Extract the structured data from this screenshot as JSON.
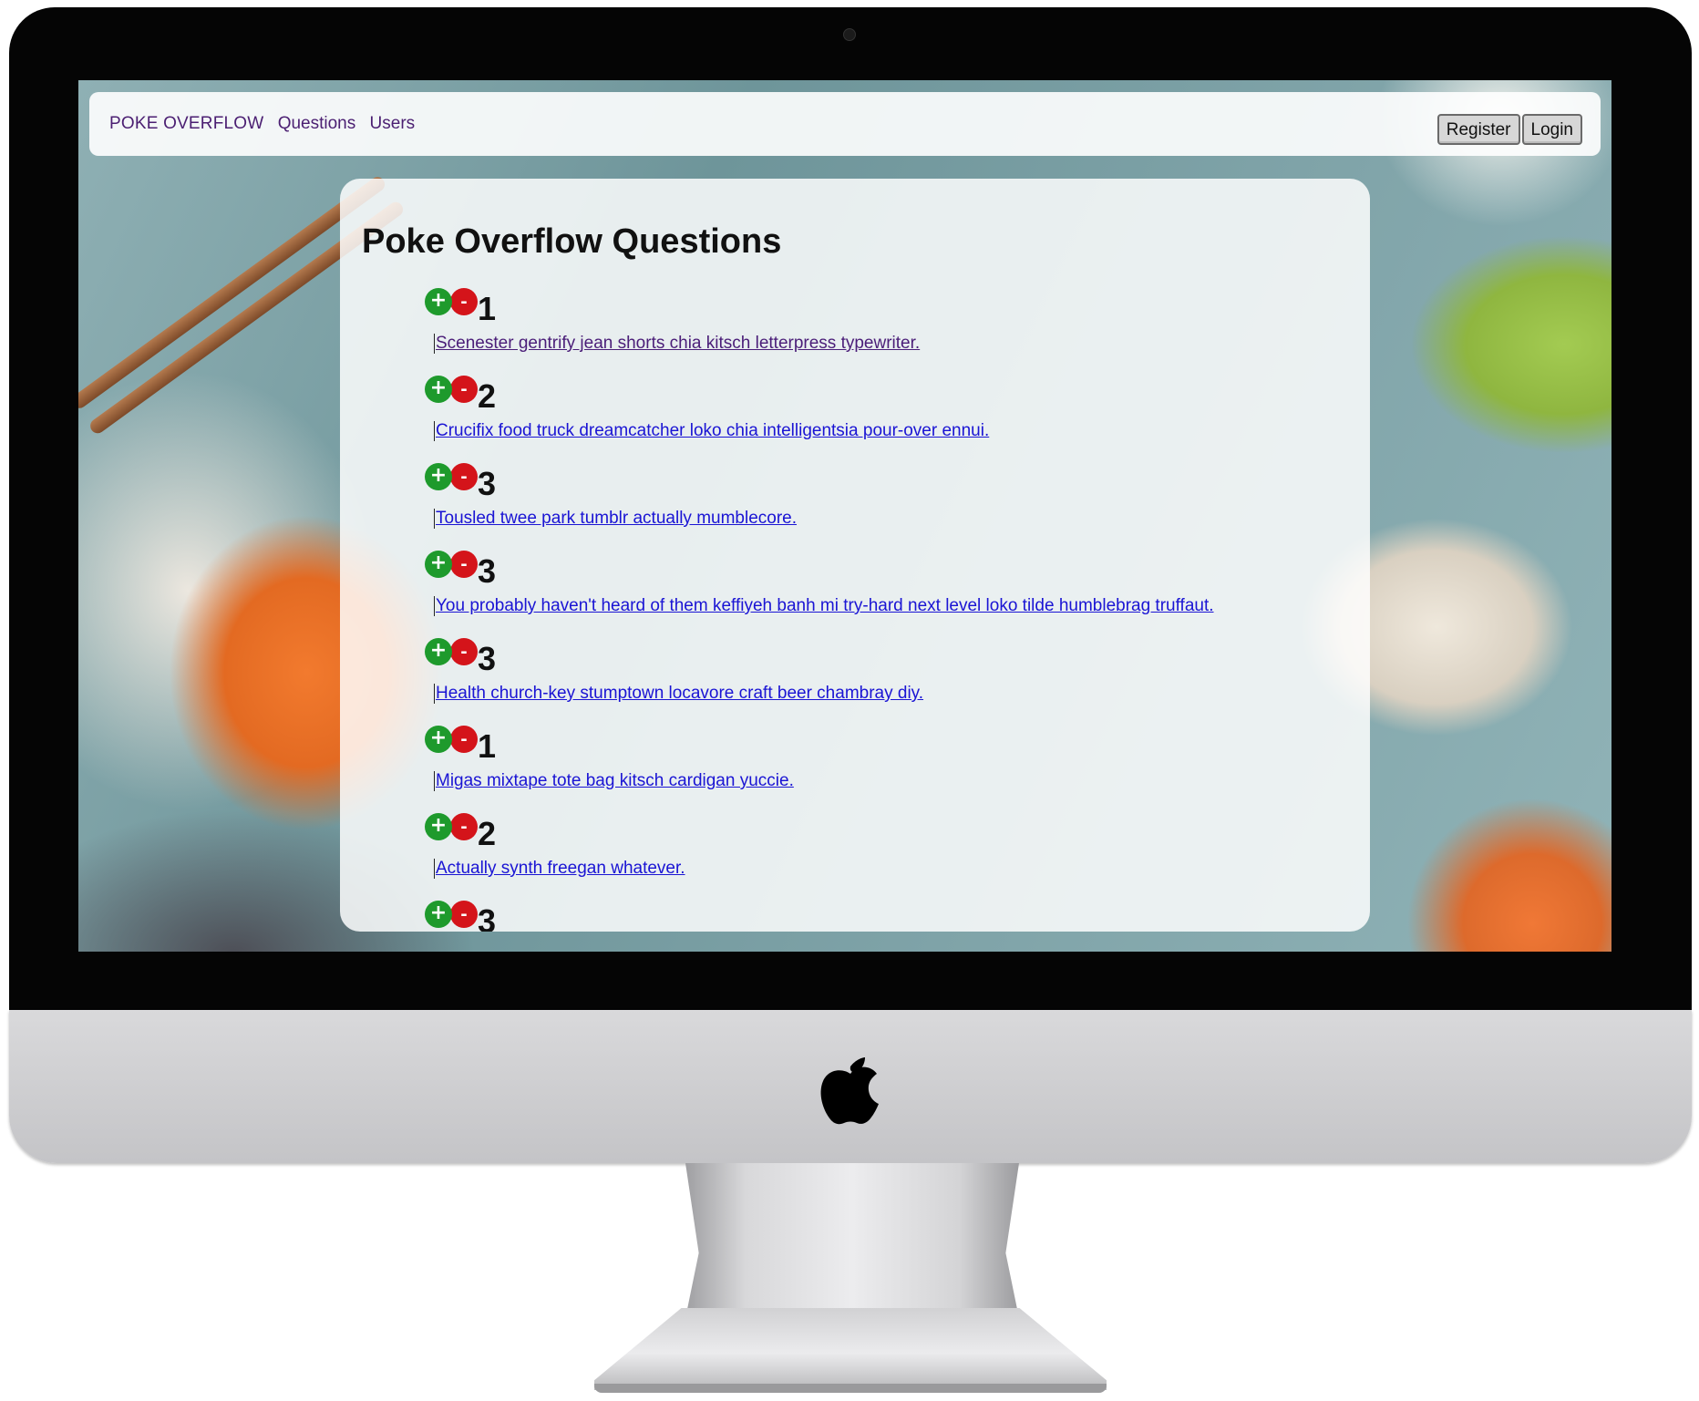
{
  "navbar": {
    "brand": "POKE OVERFLOW",
    "links": [
      "Questions",
      "Users"
    ],
    "register_label": "Register",
    "login_label": "Login"
  },
  "page": {
    "title": "Poke Overflow Questions"
  },
  "vote_icons": {
    "upvote": "+",
    "downvote": "-"
  },
  "questions": [
    {
      "score": "1",
      "title": "Scenester gentrify jean shorts chia kitsch letterpress typewriter."
    },
    {
      "score": "2",
      "title": "Crucifix food truck dreamcatcher loko chia intelligentsia pour-over ennui."
    },
    {
      "score": "3",
      "title": "Tousled twee park tumblr actually mumblecore."
    },
    {
      "score": "3",
      "title": "You probably haven't heard of them keffiyeh banh mi try-hard next level loko tilde humblebrag truffaut."
    },
    {
      "score": "3",
      "title": "Health church-key stumptown locavore craft beer chambray diy."
    },
    {
      "score": "1",
      "title": "Migas mixtape tote bag kitsch cardigan yuccie."
    },
    {
      "score": "2",
      "title": "Actually synth freegan whatever."
    },
    {
      "score": "3",
      "title": ""
    }
  ],
  "colors": {
    "upvote": "#1e9a2c",
    "downvote": "#d4141a",
    "link": "#1a14d4",
    "visited_link": "#4a1d78",
    "nav_text": "#4b1f72"
  }
}
